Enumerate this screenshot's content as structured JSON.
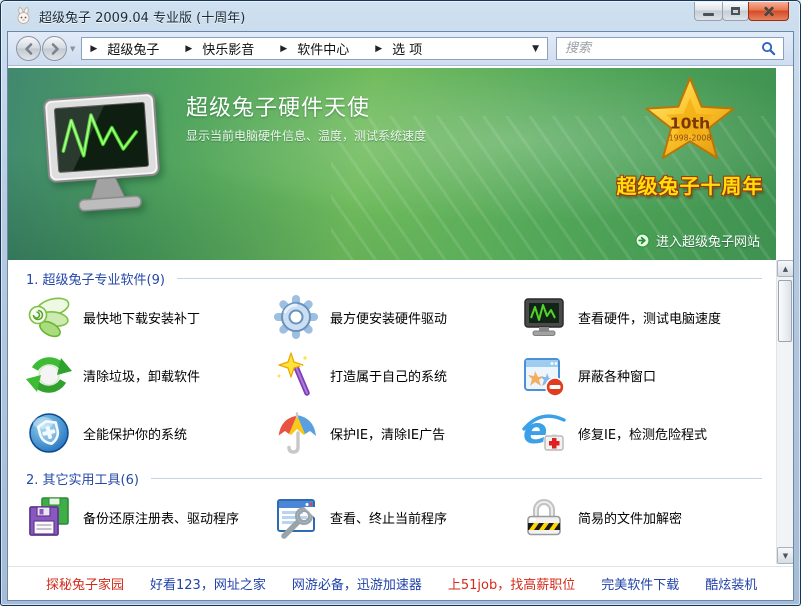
{
  "window": {
    "title": "超级兔子 2009.04 专业版 (十周年)"
  },
  "icons": {
    "breadcrumb_separator": "▶",
    "dropdown_arrow": "▼",
    "up_arrow": "▲",
    "down_arrow": "▼"
  },
  "navbar": {
    "breadcrumbs": [
      "超级兔子",
      "快乐影音",
      "软件中心",
      "选 项"
    ],
    "search_placeholder": "搜索"
  },
  "banner": {
    "title": "超级兔子硬件天使",
    "subtitle": "显示当前电脑硬件信息、温度，测试系统速度",
    "badge": {
      "top": "10th",
      "years": "1998-2008",
      "caption": "超级兔子十周年"
    },
    "site_link": "进入超级兔子网站"
  },
  "sections": [
    {
      "title": "1. 超级兔子专业软件(9)",
      "items": [
        "最快地下载安装补丁",
        "最方便安装硬件驱动",
        "查看硬件，测试电脑速度",
        "清除垃圾，卸载软件",
        "打造属于自己的系统",
        "屏蔽各种窗口",
        "全能保护你的系统",
        "保护IE，清除IE广告",
        "修复IE，检测危险程式"
      ]
    },
    {
      "title": "2. 其它实用工具(6)",
      "items": [
        "备份还原注册表、驱动程序",
        "查看、终止当前程序",
        "简易的文件加解密"
      ]
    }
  ],
  "footer": {
    "links": [
      {
        "label": "探秘兔子家园",
        "color": "#d42a1a"
      },
      {
        "label": "好看123，网址之家",
        "color": "#2142a8"
      },
      {
        "label": "网游必备，迅游加速器",
        "color": "#2142a8"
      },
      {
        "label": "上51job，找高薪职位",
        "color": "#d42a1a"
      },
      {
        "label": "完美软件下载",
        "color": "#2142a8"
      },
      {
        "label": "酷炫装机",
        "color": "#2142a8"
      }
    ]
  },
  "colors": {
    "banner_green": "#5aa95c",
    "section_title_blue": "#2448a8",
    "link_red": "#d42a1a",
    "link_blue": "#2142a8",
    "badge_yellow": "#ffe10a"
  }
}
